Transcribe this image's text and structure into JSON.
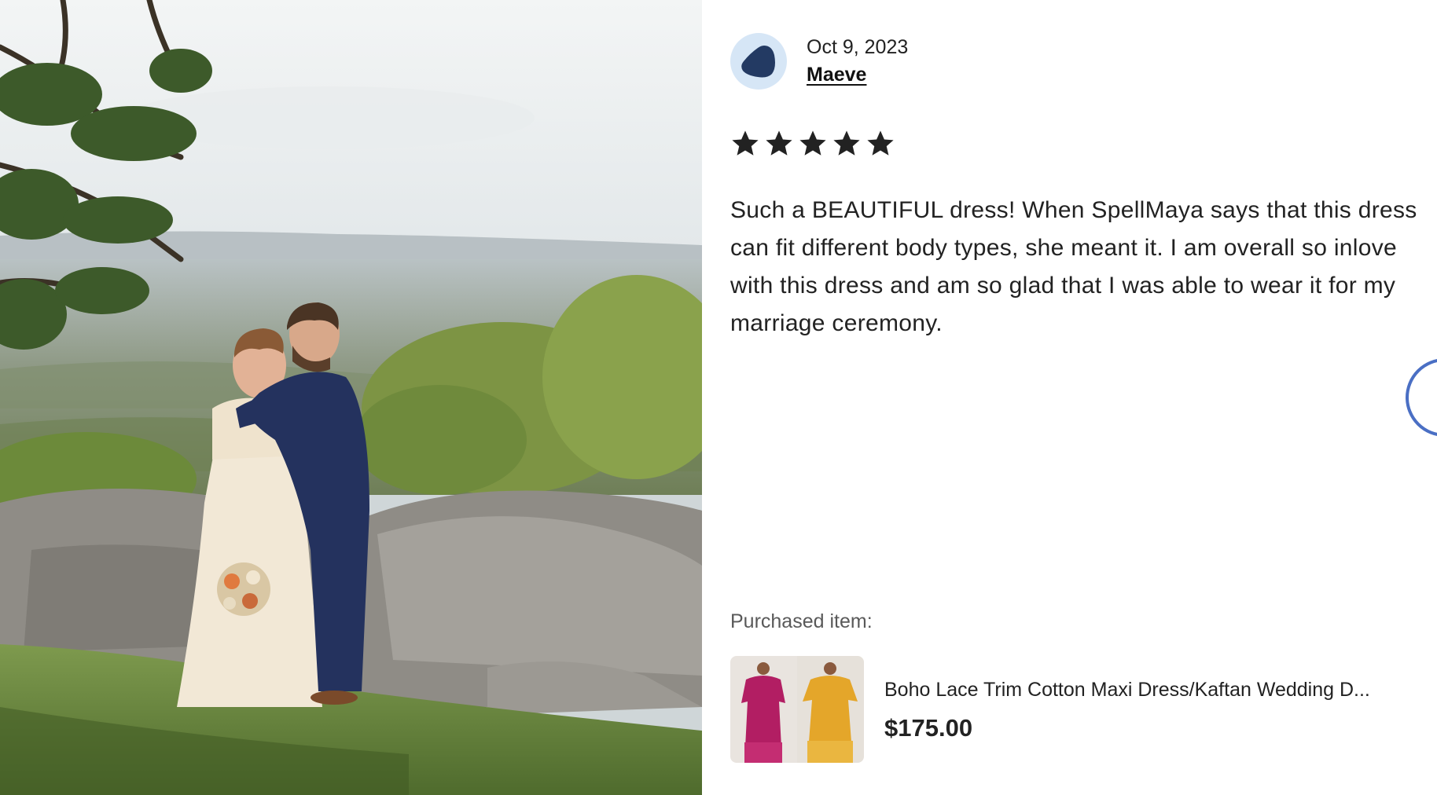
{
  "review": {
    "date": "Oct 9, 2023",
    "reviewer_name": "Maeve",
    "rating": 5,
    "rating_max": 5,
    "text": "Such a BEAUTIFUL dress! When SpellMaya says that this dress can fit different body types, she meant it. I am overall so inlove with this dress and am so glad that I was able to wear it for my marriage ceremony."
  },
  "purchased": {
    "label": "Purchased item:",
    "title": "Boho Lace Trim Cotton Maxi Dress/Kaftan Wedding D...",
    "price": "$175.00"
  },
  "icons": {
    "avatar": "avatar-icon",
    "star": "star-icon",
    "next": "next-arrow-button"
  },
  "colors": {
    "avatar_bg": "#d6e6f6",
    "avatar_shape": "#233a63",
    "star": "#222222",
    "next_button_border": "#4a6fc4"
  }
}
